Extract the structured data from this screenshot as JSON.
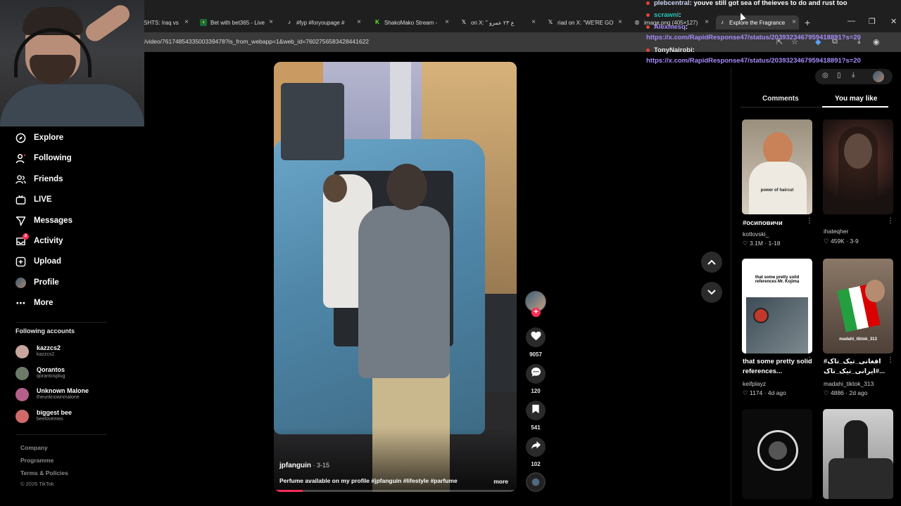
{
  "browser": {
    "tabs": [
      {
        "title": "SHTS: Iraq vs",
        "icon": "dot-icon",
        "left": 0
      },
      {
        "title": "Bet with bet365 - Live",
        "icon": "bet365-icon"
      },
      {
        "title": "#fyp #foryoupage #",
        "icon": "tiktok-icon"
      },
      {
        "title": "ShakoMako Stream -",
        "icon": "kick-icon"
      },
      {
        "title": "on X: \" ع ٢٣ عمرو",
        "icon": "x-icon"
      },
      {
        "title": "riad on X: \"WE'RE GO",
        "icon": "x-icon"
      },
      {
        "title": "image.png (405×127)",
        "icon": "globe-icon"
      },
      {
        "title": "Explore the Fragrance",
        "icon": "tiktok-icon"
      }
    ],
    "url": "/video/7617485433500339478?is_from_webapp=1&web_id=7602756583428441622"
  },
  "nav": {
    "items": [
      {
        "label": "Explore",
        "icon": "compass-icon"
      },
      {
        "label": "Following",
        "icon": "person-icon"
      },
      {
        "label": "Friends",
        "icon": "friends-icon"
      },
      {
        "label": "LIVE",
        "icon": "live-tv-icon"
      },
      {
        "label": "Messages",
        "icon": "send-icon"
      },
      {
        "label": "Activity",
        "icon": "inbox-icon",
        "badge": "2"
      },
      {
        "label": "Upload",
        "icon": "plus-square-icon"
      },
      {
        "label": "Profile",
        "icon": "profile-avatar"
      },
      {
        "label": "More",
        "icon": "ellipsis-icon"
      }
    ],
    "following_title": "Following accounts",
    "following_accounts": [
      {
        "name": "kazzcs2",
        "handle": "kazzcs2",
        "color": "#c7a6a0"
      },
      {
        "name": "Qorantos",
        "handle": "qorantosplug",
        "color": "#6c7a6a"
      },
      {
        "name": "Unknown Malone",
        "handle": "theunknownmalone",
        "color": "#b5608a"
      },
      {
        "name": "biggest bee",
        "handle": "beelovemes",
        "color": "#d06a6a"
      }
    ],
    "footer": [
      "Company",
      "Programme",
      "Terms & Policies"
    ],
    "copyright": "© 2026 TikTok"
  },
  "video": {
    "author": "jpfanguin",
    "date": " · 3-15",
    "description": "Perfume available on my profile #jpfanguin #lifestyle #parfume",
    "more_label": "more",
    "progress": 0.12
  },
  "actions": {
    "likes": "9057",
    "comments": "120",
    "saves": "541",
    "shares": "102"
  },
  "chat": [
    {
      "user": "plebcentral",
      "text": ": youve still got sea of theieves to do and rust too",
      "color": "#cdd5f3"
    },
    {
      "user": "scrawni",
      "text": ":",
      "color": "#26c2b8"
    },
    {
      "user": "Alexmesq",
      "text": ":",
      "color": "#a78bfa"
    },
    {
      "link": "https://x.com/RapidResponse47/status/2039323467959418891?s=20"
    },
    {
      "user": "TonyNairobi",
      "text": ":",
      "color": "#e8e8e8"
    },
    {
      "link": "https://x.com/RapidResponse47/status/2039323467959418891?s=20"
    }
  ],
  "right": {
    "tab_comments": "Comments",
    "tab_you_may_like": "You may like",
    "cards": [
      {
        "caption": "#осиповичи",
        "user": "kotlovski_",
        "likes": "3.1M",
        "date": "1-18",
        "thumb_text": "power of haircut",
        "bg": "#b7b2a6"
      },
      {
        "caption": "",
        "user": "ihateqher",
        "likes": "459K",
        "date": "3-9",
        "thumb_text": "",
        "bg": "#1a1210"
      },
      {
        "caption": "that some pretty solid references...",
        "user": "keifplayz",
        "likes": "1174",
        "date": "4d ago",
        "thumb_text": "that some pretty solid references Mr. Kojima",
        "bg": "#ffffff"
      },
      {
        "caption": "#افغانی_تیک_تاک #ایرانی_تیک_تاک...",
        "user": "madahi_tiktok_313",
        "likes": "4886",
        "date": "2d ago",
        "thumb_text": "madahi_tiktok_313",
        "bg": "#8a7766"
      },
      {
        "caption": "",
        "user": "",
        "likes": "",
        "date": "",
        "thumb_text": "",
        "bg": "#0b0b0b"
      },
      {
        "caption": "",
        "user": "",
        "likes": "",
        "date": "",
        "thumb_text": "",
        "bg": "#d8d8d8"
      }
    ]
  }
}
